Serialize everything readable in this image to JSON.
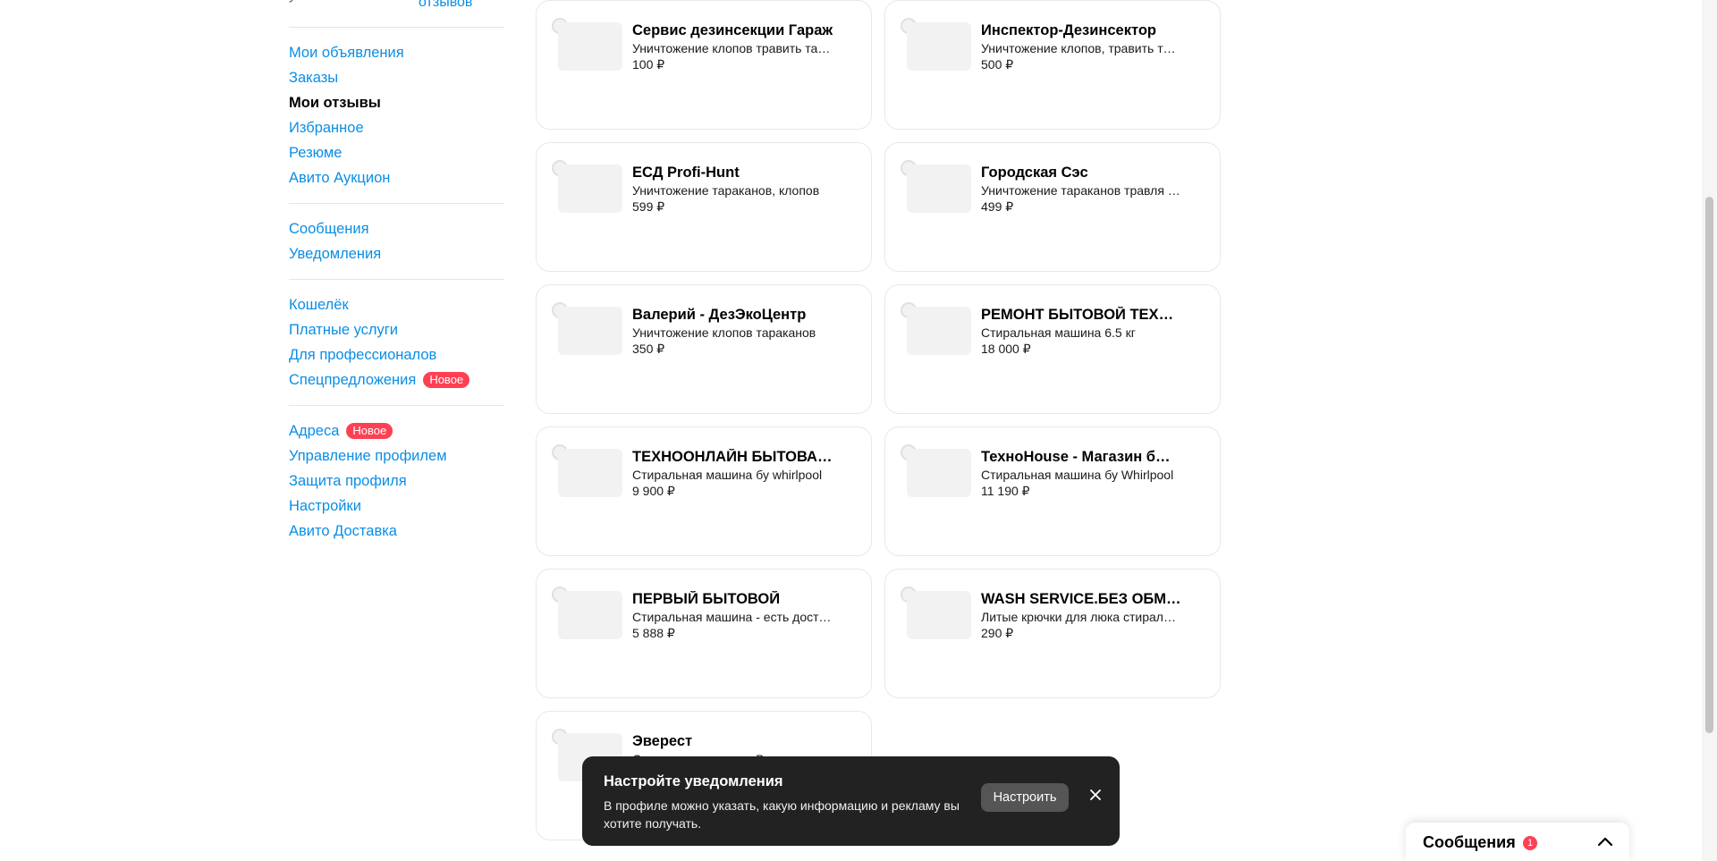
{
  "sidebar": {
    "top_stub": "у",
    "reviews_link": "отзывов",
    "groups": [
      {
        "items": [
          {
            "label": "Мои объявления"
          },
          {
            "label": "Заказы"
          },
          {
            "label": "Мои отзывы",
            "active": true
          },
          {
            "label": "Избранное"
          },
          {
            "label": "Резюме"
          },
          {
            "label": "Авито Аукцион"
          }
        ]
      },
      {
        "items": [
          {
            "label": "Сообщения"
          },
          {
            "label": "Уведомления"
          }
        ]
      },
      {
        "items": [
          {
            "label": "Кошелёк"
          },
          {
            "label": "Платные услуги"
          },
          {
            "label": "Для профессионалов"
          },
          {
            "label": "Спецпредложения",
            "badge": "Новое"
          }
        ]
      },
      {
        "items": [
          {
            "label": "Адреса",
            "badge": "Новое"
          },
          {
            "label": "Управление профилем"
          },
          {
            "label": "Защита профиля"
          },
          {
            "label": "Настройки"
          },
          {
            "label": "Авито Доставка"
          }
        ]
      }
    ]
  },
  "cards": [
    {
      "title": "Сервис дезинсекции Гараж",
      "description": "Уничтожение клопов травить тараканов",
      "price": "100 ₽"
    },
    {
      "title": "Инспектор-Дезинсектор",
      "description": "Уничтожение клопов, травить тараканов",
      "price": "500 ₽"
    },
    {
      "title": "ЕСД Profi-Hunt",
      "description": "Уничтожение тараканов, клопов",
      "price": "599 ₽"
    },
    {
      "title": "Городская Сэс",
      "description": "Уничтожение тараканов травля клопов",
      "price": "499 ₽"
    },
    {
      "title": "Валерий - ДезЭкоЦентр",
      "description": "Уничтожение клопов тараканов",
      "price": "350 ₽"
    },
    {
      "title": "РЕМОНТ БЫТОВОЙ ТЕХНИКИ",
      "description": "Стиральная машина 6.5 кг",
      "price": "18 000 ₽"
    },
    {
      "title": "ТЕХНООНЛАЙН БЫТОВАЯ ТЕХНИКА",
      "description": "Стиральная машина бу whirlpool",
      "price": "9 900 ₽"
    },
    {
      "title": "ТехноHouse - Магазин бытовой",
      "description": "Стиральная машина бу Whirlpool",
      "price": "11 190 ₽"
    },
    {
      "title": "ПЕРВЫЙ БЫТОВОЙ",
      "description": "Стиральная машина - есть доставка",
      "price": "5 888 ₽"
    },
    {
      "title": "WASH SERVICE.БЕЗ ОБМАНА",
      "description": "Литые крючки для люка стиральной",
      "price": "290 ₽"
    },
    {
      "title": "Эверест",
      "description": "Стиральная машина Вирпул",
      "price": ""
    }
  ],
  "toast": {
    "title": "Настройте уведомления",
    "text": "В профиле можно указать, какую информацию и рекламу вы хотите получать.",
    "button": "Настроить"
  },
  "messenger": {
    "label": "Сообщения",
    "count": "1"
  },
  "colors": {
    "link": "#0a8ee5",
    "badge": "#ff4053",
    "toast_bg": "#222222"
  }
}
